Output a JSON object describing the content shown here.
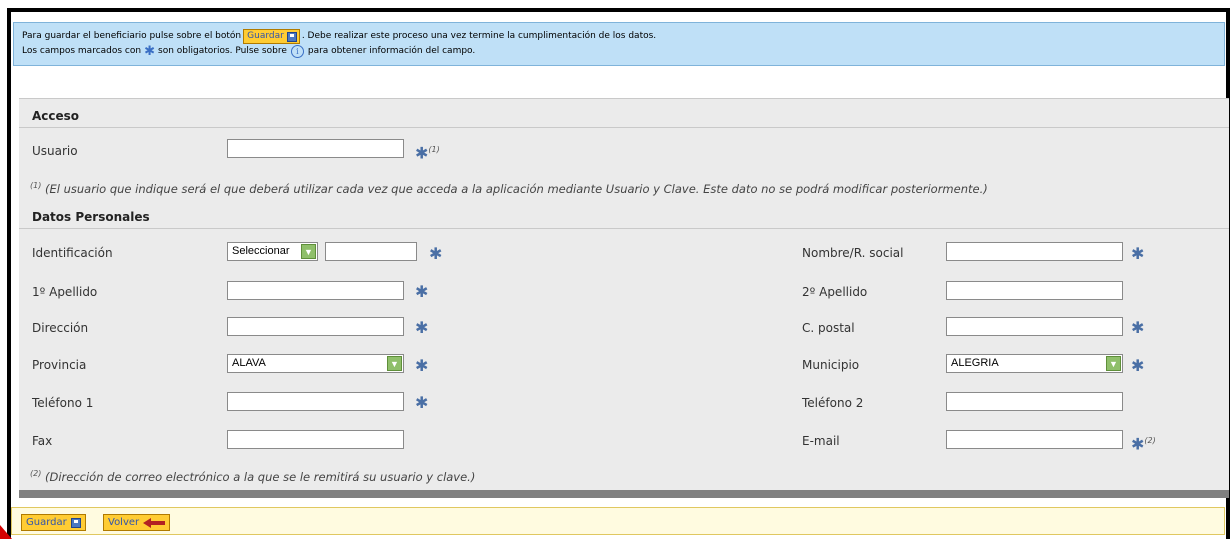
{
  "info": {
    "line1_before": "Para guardar el beneficiario pulse sobre el botón",
    "save_label": "Guardar",
    "line1_after": ". Debe realizar este proceso una vez termine la cumplimentación de los datos.",
    "line2_before": "Los campos marcados con",
    "line2_middle": "son obligatorios. Pulse sobre",
    "line2_after": "para obtener información del campo."
  },
  "sections": {
    "acceso": "Acceso",
    "datos_personales": "Datos Personales"
  },
  "fields": {
    "usuario": {
      "label": "Usuario",
      "value": "",
      "note_mark": "(1)"
    },
    "identificacion": {
      "label": "Identificación",
      "select_value": "Seleccionar",
      "value": ""
    },
    "nombre": {
      "label": "Nombre/R. social",
      "value": ""
    },
    "apellido1": {
      "label": "1º Apellido",
      "value": ""
    },
    "apellido2": {
      "label": "2º Apellido",
      "value": ""
    },
    "direccion": {
      "label": "Dirección",
      "value": ""
    },
    "cpostal": {
      "label": "C. postal",
      "value": ""
    },
    "provincia": {
      "label": "Provincia",
      "select_value": "ALAVA"
    },
    "municipio": {
      "label": "Municipio",
      "select_value": "ALEGRIA"
    },
    "telefono1": {
      "label": "Teléfono 1",
      "value": ""
    },
    "telefono2": {
      "label": "Teléfono 2",
      "value": ""
    },
    "fax": {
      "label": "Fax",
      "value": ""
    },
    "email": {
      "label": "E-mail",
      "value": "",
      "note_mark": "(2)"
    }
  },
  "notes": {
    "note1_mark": "(1)",
    "note1_text": "(El usuario que indique será el que deberá utilizar cada vez que acceda a la aplicación mediante Usuario y Clave. Este dato no se podrá modificar posteriormente.)",
    "note2_mark": "(2)",
    "note2_text": "(Dirección de correo electrónico a la que se le remitirá su usuario y clave.)"
  },
  "footer": {
    "save_label": "Guardar",
    "back_label": "Volver"
  },
  "icons": {
    "required": "asterisk-icon",
    "info": "info-circle-icon",
    "save": "floppy-disk-icon",
    "back": "back-arrow-icon"
  },
  "colors": {
    "info_bg": "#bfe0f7",
    "panel_bg": "#ebebeb",
    "button_bg": "#ffcc33",
    "required_mark": "#4a6fa5"
  }
}
